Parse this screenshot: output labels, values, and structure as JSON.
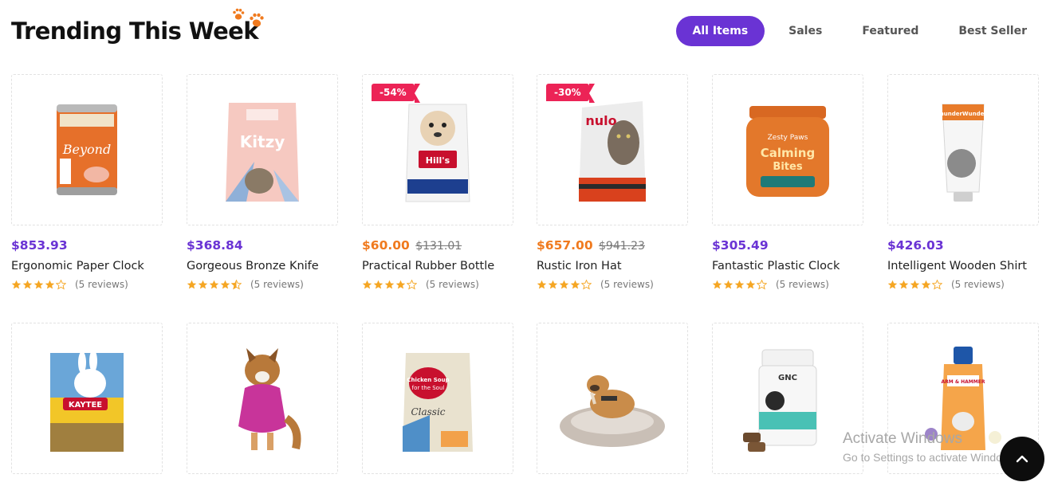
{
  "header": {
    "title": "Trending This Week",
    "tabs": [
      "All Items",
      "Sales",
      "Featured",
      "Best Seller"
    ],
    "active_tab": "All Items"
  },
  "colors": {
    "accent": "#6a33d4",
    "sale": "#f07a1e",
    "badge": "#ec2356",
    "star": "#f5a623"
  },
  "products": [
    {
      "name": "Ergonomic Paper Clock",
      "price": "$853.93",
      "old_price": "",
      "badge": "",
      "rating": 4,
      "reviews": "(5 reviews)",
      "image": "dog-food-can"
    },
    {
      "name": "Gorgeous Bronze Knife",
      "price": "$368.84",
      "old_price": "",
      "badge": "",
      "rating": 4.5,
      "reviews": "(5 reviews)",
      "image": "kitzy-cat-food-bag"
    },
    {
      "name": "Practical Rubber Bottle",
      "price": "$60.00",
      "old_price": "$131.01",
      "badge": "-54%",
      "rating": 4,
      "reviews": "(5 reviews)",
      "image": "hills-dog-food-bag"
    },
    {
      "name": "Rustic Iron Hat",
      "price": "$657.00",
      "old_price": "$941.23",
      "badge": "-30%",
      "rating": 4,
      "reviews": "(5 reviews)",
      "image": "nulo-cat-food-bag"
    },
    {
      "name": "Fantastic Plastic Clock",
      "price": "$305.49",
      "old_price": "",
      "badge": "",
      "rating": 4,
      "reviews": "(5 reviews)",
      "image": "calming-bites-jar"
    },
    {
      "name": "Intelligent Wooden Shirt",
      "price": "$426.03",
      "old_price": "",
      "badge": "",
      "rating": 4,
      "reviews": "(5 reviews)",
      "image": "calming-gel-tube"
    },
    {
      "name": "",
      "price": "",
      "old_price": "",
      "badge": "",
      "rating": 0,
      "reviews": "",
      "image": "kaytee-rabbit-food-bag"
    },
    {
      "name": "",
      "price": "",
      "old_price": "",
      "badge": "",
      "rating": 0,
      "reviews": "",
      "image": "dog-wearing-shirt"
    },
    {
      "name": "",
      "price": "",
      "old_price": "",
      "badge": "",
      "rating": 0,
      "reviews": "",
      "image": "chicken-soup-dog-food-bag"
    },
    {
      "name": "",
      "price": "",
      "old_price": "",
      "badge": "",
      "rating": 0,
      "reviews": "",
      "image": "dog-on-round-bed"
    },
    {
      "name": "",
      "price": "",
      "old_price": "",
      "badge": "",
      "rating": 0,
      "reviews": "",
      "image": "gnc-chews-jar"
    },
    {
      "name": "",
      "price": "",
      "old_price": "",
      "badge": "",
      "rating": 0,
      "reviews": "",
      "image": "shampoo-bottle"
    }
  ],
  "watermark": {
    "line1": "Activate Windows",
    "line2": "Go to Settings to activate Windows."
  },
  "scroll_top_icon": "chevron-up-icon"
}
